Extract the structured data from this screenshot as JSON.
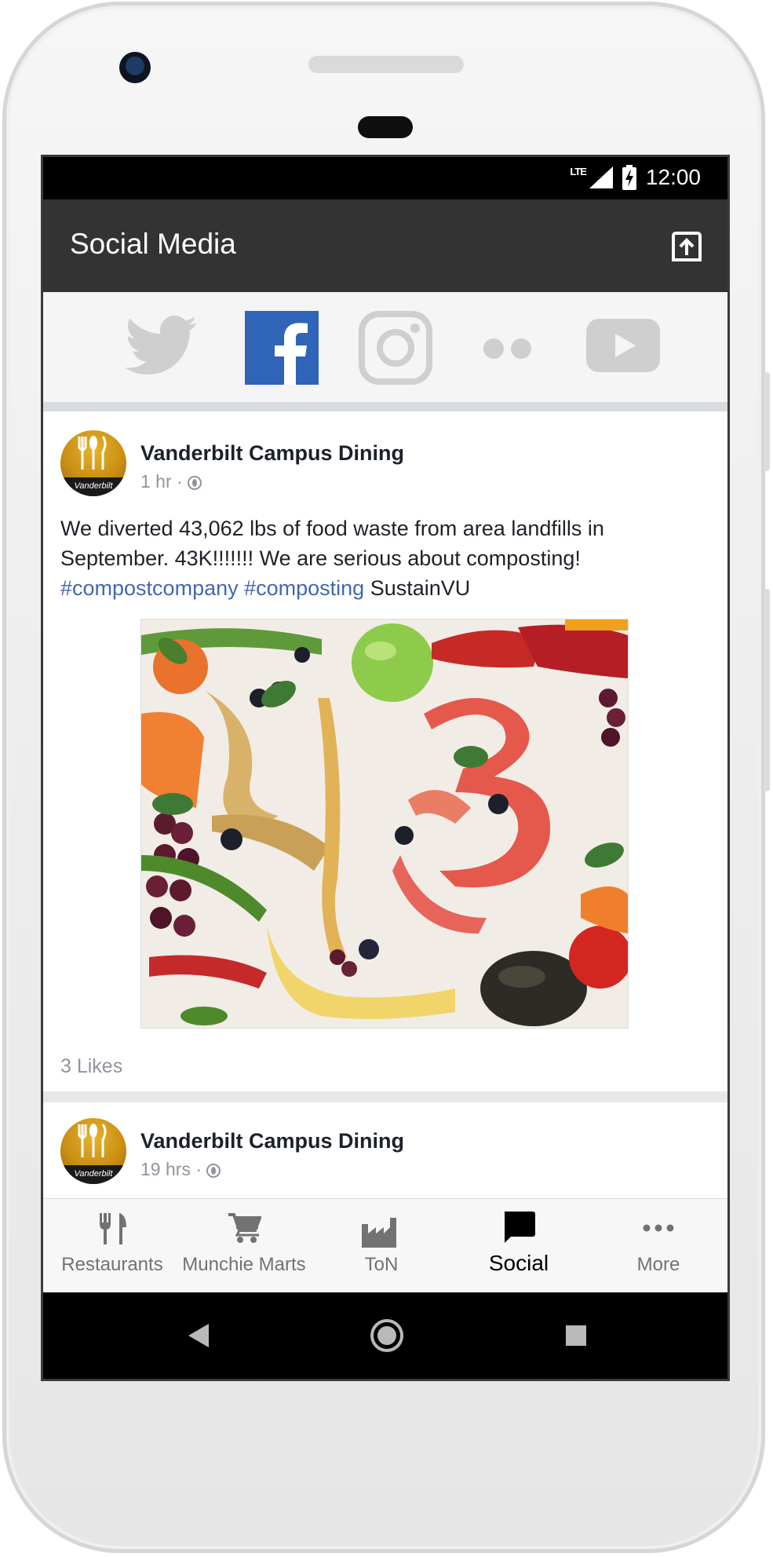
{
  "status_bar": {
    "network": "LTE",
    "time": "12:00"
  },
  "app_bar": {
    "title": "Social Media",
    "action_icon": "share-upload-icon"
  },
  "social_tabs": [
    {
      "name": "twitter",
      "icon": "twitter-icon",
      "active": false
    },
    {
      "name": "facebook",
      "icon": "facebook-icon",
      "active": true
    },
    {
      "name": "instagram",
      "icon": "instagram-icon",
      "active": false
    },
    {
      "name": "flickr",
      "icon": "flickr-icon",
      "active": false
    },
    {
      "name": "youtube",
      "icon": "youtube-icon",
      "active": false
    }
  ],
  "posts": [
    {
      "author": "Vanderbilt Campus Dining",
      "avatar_caption": "Vanderbilt",
      "time": "1 hr ·",
      "text_plain": "We diverted 43,062 lbs of food waste from area landfills in September. 43K!!!!!!! We are serious about composting!",
      "hashtags": "#compostcompany #composting",
      "text_tail": "SustainVU",
      "likes": "3 Likes"
    },
    {
      "author": "Vanderbilt Campus Dining",
      "avatar_caption": "Vanderbilt",
      "time": "19 hrs ·"
    }
  ],
  "bottom_nav": [
    {
      "label": "Restaurants",
      "icon": "fork-knife-icon",
      "active": false
    },
    {
      "label": "Munchie Marts",
      "icon": "cart-icon",
      "active": false
    },
    {
      "label": "ToN",
      "icon": "factory-icon",
      "active": false
    },
    {
      "label": "Social",
      "icon": "chat-bubble-icon",
      "active": true
    },
    {
      "label": "More",
      "icon": "more-dots-icon",
      "active": false
    }
  ],
  "colors": {
    "app_bar": "#333333",
    "facebook_blue": "#3b5998",
    "hashtag": "#4267b2",
    "inactive_icon": "#cfcfcf"
  }
}
